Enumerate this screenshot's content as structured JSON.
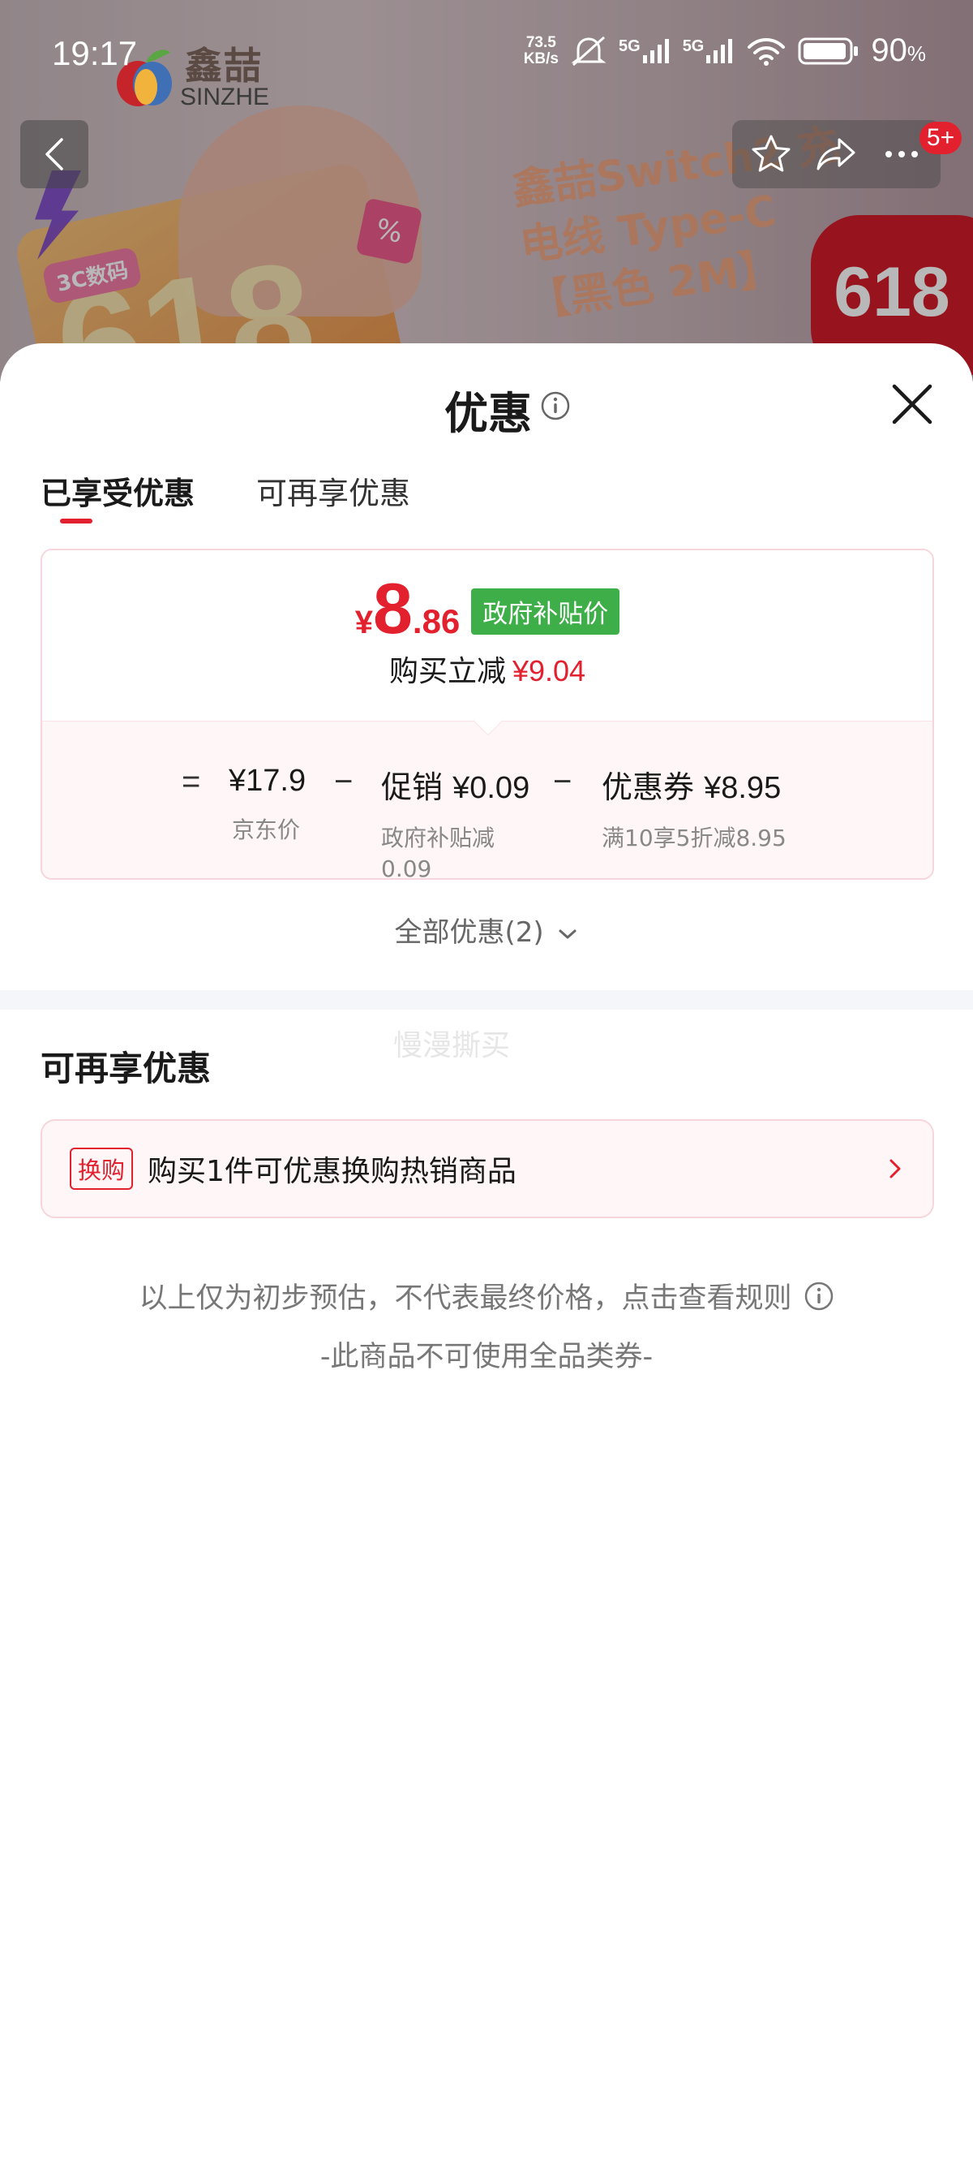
{
  "status_bar": {
    "time": "19:17",
    "net_speed_value": "73.5",
    "net_speed_unit": "KB/s",
    "signal1": "5G",
    "signal2": "5G",
    "battery_value": "90",
    "battery_unit": "%"
  },
  "background": {
    "logo_cn": "鑫喆",
    "logo_en": "SINZHE",
    "tag_3c": "3C数码",
    "big_618": "618",
    "product_title": "鑫喆Switch2 充电线 Type-C 【黑色 2M】",
    "badge_618": "618",
    "cart_badge": "5+"
  },
  "sheet": {
    "title": "优惠",
    "tabs": [
      {
        "label": "已享受优惠",
        "active": true
      },
      {
        "label": "可再享优惠",
        "active": false
      }
    ],
    "price_card": {
      "currency": "¥",
      "price_int": "8",
      "price_dec": ".86",
      "gov_tag": "政府补贴价",
      "reduce_label": "购买立减",
      "reduce_amount": "¥9.04",
      "formula": {
        "eq": "=",
        "jd_price": "¥17.9",
        "jd_label": "京东价",
        "minus1": "−",
        "promo_label": "促销",
        "promo_amount": "¥0.09",
        "promo_desc_line1": "政府补贴减",
        "promo_desc_line2": "0.09",
        "minus2": "−",
        "coupon_label": "优惠券",
        "coupon_amount": "¥8.95",
        "coupon_desc": "满10享5折减8.95"
      }
    },
    "all_offers": "全部优惠(2)",
    "watermark": "慢漫撕买",
    "more_section_title": "可再享优惠",
    "swap": {
      "tag": "换购",
      "text": "购买1件可优惠换购热销商品"
    },
    "note1": "以上仅为初步预估，不代表最终价格，点击查看规则",
    "note2": "-此商品不可使用全品类券-"
  },
  "colors": {
    "accent_red": "#e3202e",
    "gov_green": "#3dae48",
    "card_border": "#f7d5dc",
    "card_tint": "#fff6f8"
  }
}
